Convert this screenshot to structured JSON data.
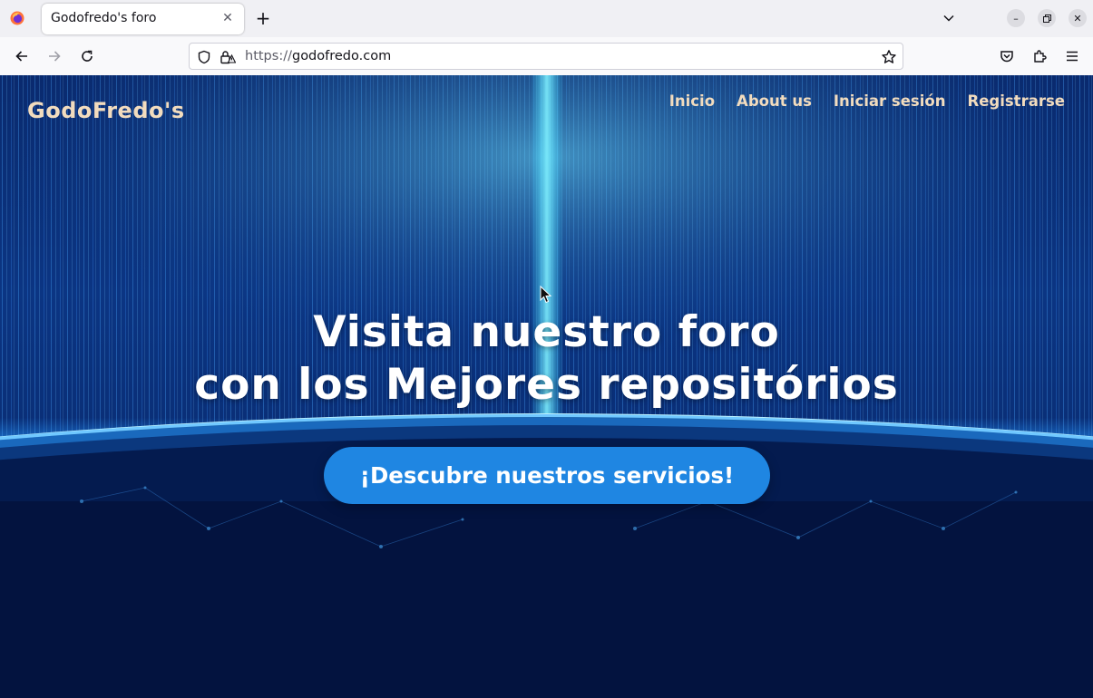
{
  "browser": {
    "tab_title": "Godofredo's foro",
    "url_scheme": "https://",
    "url_host": "godofredo.com"
  },
  "site": {
    "logo": "GodoFredo's",
    "nav": [
      "Inicio",
      "About us",
      "Iniciar sesión",
      "Registrarse"
    ],
    "hero_line1": "Visita nuestro foro",
    "hero_line2": "con los Mejores repositórios",
    "cta_label": "¡Descubre nuestros servicios!"
  },
  "colors": {
    "accent": "#1f86e2",
    "logo_text": "#f2dcbe",
    "page_bg": "#020a25"
  }
}
